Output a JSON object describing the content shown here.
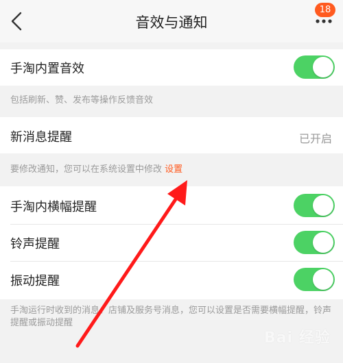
{
  "header": {
    "title": "音效与通知",
    "badge": "18",
    "back_icon": "chevron-left-icon",
    "more_icon": "more-dots-icon"
  },
  "sections": {
    "sound": {
      "label": "手淘内置音效",
      "enabled": true,
      "hint": "包括刷新、赞、发布等操作反馈音效"
    },
    "new_message": {
      "label": "新消息提醒",
      "value": "已开启",
      "hint_prefix": "要修改通知，您可以在系统设置中修改",
      "hint_link": "设置"
    },
    "banner": {
      "label": "手淘内横幅提醒",
      "enabled": true
    },
    "ringtone": {
      "label": "铃声提醒",
      "enabled": true
    },
    "vibrate": {
      "label": "振动提醒",
      "enabled": true
    },
    "footer_hint": "手淘运行时收到的消息、店铺及服务号消息，您可以设置是否需要横幅提醒，铃声提醒或振动提醒"
  },
  "colors": {
    "accent": "#ff5a1f",
    "toggle_on": "#4cd264",
    "annotation_arrow": "#ff1a1a"
  },
  "watermark": {
    "text": "Bai 经验"
  }
}
